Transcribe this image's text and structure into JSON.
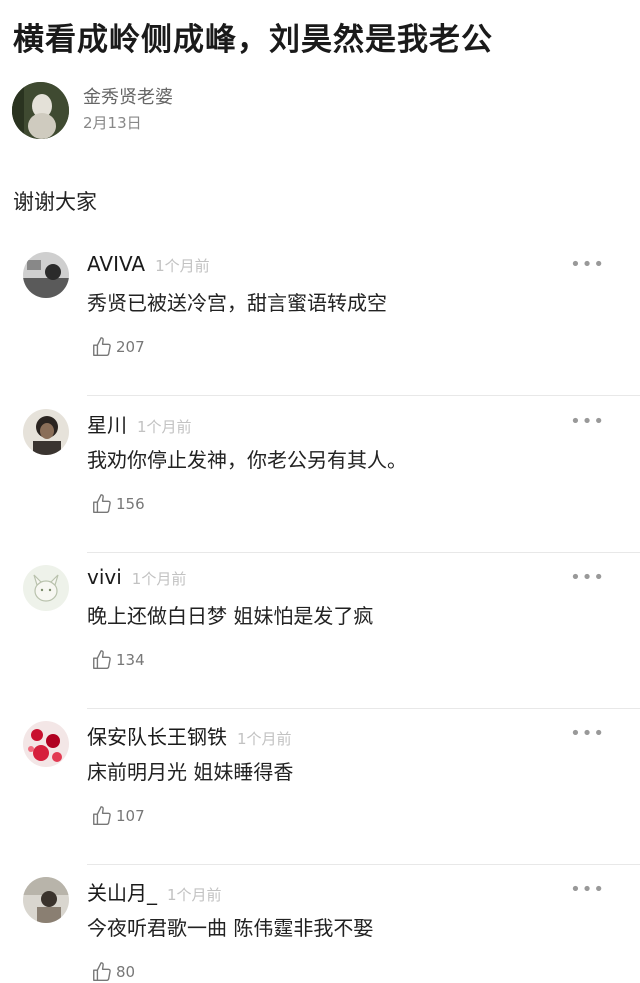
{
  "post": {
    "title": "横看成岭侧成峰，刘昊然是我老公",
    "author": "金秀贤老婆",
    "date": "2月13日",
    "body": "谢谢大家"
  },
  "comments": [
    {
      "name": "AVIVA",
      "time": "1个月前",
      "text": "秀贤已被送冷宫，甜言蜜语转成空",
      "likes": "207",
      "more": "•••"
    },
    {
      "name": "星川",
      "time": "1个月前",
      "text": "我劝你停止发神，你老公另有其人。",
      "likes": "156",
      "more": "•••"
    },
    {
      "name": "vivi",
      "time": "1个月前",
      "text": "晚上还做白日梦 姐妹怕是发了疯",
      "likes": "134",
      "more": "•••"
    },
    {
      "name": "保安队长王钢铁",
      "time": "1个月前",
      "text": "床前明月光 姐妹睡得香",
      "likes": "107",
      "more": "•••"
    },
    {
      "name": "关山月_",
      "time": "1个月前",
      "text": "今夜听君歌一曲 陈伟霆非我不娶",
      "likes": "80",
      "more": "•••"
    }
  ],
  "icons": {
    "like": "thumbs-up-outline-icon",
    "more": "ellipsis-icon"
  }
}
